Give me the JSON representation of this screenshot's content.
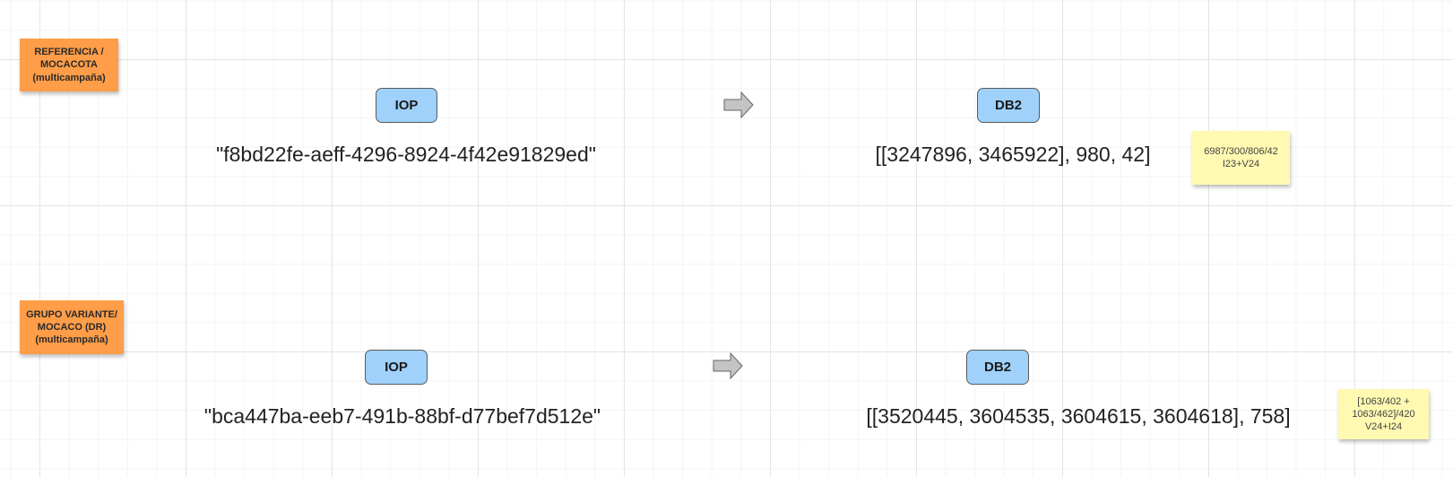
{
  "row1": {
    "label_lines": [
      "REFERENCIA /",
      "MOCACOTA",
      "(multicampaña)"
    ],
    "source_system": "IOP",
    "source_value": "\"f8bd22fe-aeff-4296-8924-4f42e91829ed\"",
    "target_system": "DB2",
    "target_value": "[[3247896, 3465922],  980, 42]",
    "note_lines": [
      "6987/300/806/42",
      "I23+V24"
    ]
  },
  "row2": {
    "label_lines": [
      "GRUPO VARIANTE/",
      "MOCACO (DR)",
      "(multicampaña)"
    ],
    "source_system": "IOP",
    "source_value": "\"bca447ba-eeb7-491b-88bf-d77bef7d512e\"",
    "target_system": "DB2",
    "target_value": "[[3520445, 3604535, 3604615, 3604618],  758]",
    "note_lines": [
      "[1063/402 +",
      "1063/462]/420",
      "V24+I24"
    ]
  },
  "colors": {
    "orange_sticky": "#ff9d48",
    "yellow_sticky": "#fff9b1",
    "system_pill": "#9fd1fa",
    "arrow": "#c4c4c4"
  }
}
